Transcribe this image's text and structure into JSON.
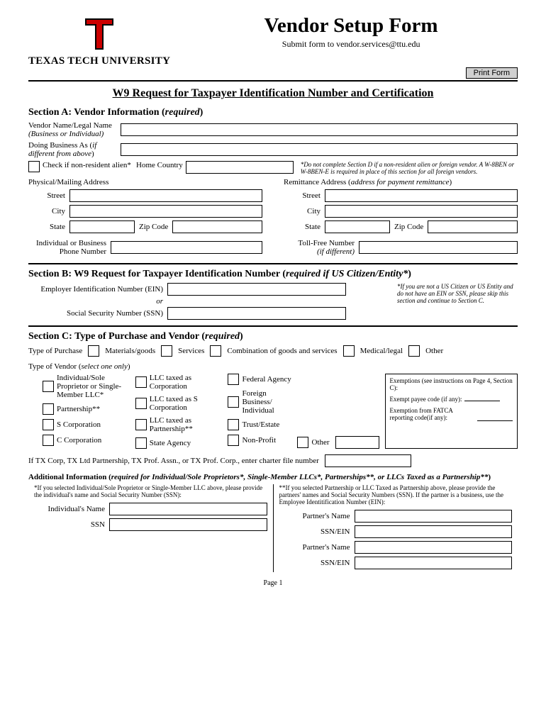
{
  "header": {
    "university": "TEXAS TECH UNIVERSITY",
    "title": "Vendor Setup Form",
    "submit": "Submit form to vendor.services@ttu.edu",
    "print": "Print Form"
  },
  "w9_title": "W9 Request for Taxpayer Identification Number and Certification",
  "secA": {
    "hdr": "Section A: Vendor Information (",
    "hdr_req": "required",
    "hdr_end": ")",
    "vendor_name": "Vendor Name/Legal Name",
    "vendor_name_sub": "(Business or Individual)",
    "dba": "Doing Business As (",
    "dba_sub": "if different from above",
    "dba_end": ")",
    "nonres": "Check if non-resident alien*",
    "home_country": "Home Country",
    "nonres_note": "*Do not complete Section D if a non-resident alien or foreign vendor. A W-8BEN or W-8BEN-E is required in place of this section for all foreign vendors.",
    "phys": "Physical/Mailing Address",
    "remit": "Remittance Address (",
    "remit_sub": "address for payment remittance",
    "remit_end": ")",
    "street": "Street",
    "city": "City",
    "state": "State",
    "zip": "Zip Code",
    "phone": "Individual or Business",
    "phone2": "Phone Number",
    "tollfree": "Toll-Free Number",
    "tollfree_sub": "(if different)"
  },
  "secB": {
    "hdr": "Section B: W9 Request for Taxpayer Identification Number (",
    "hdr_req": "required if US Citizen/Entity*",
    "hdr_end": ")",
    "ein": "Employer Identification Number (EIN)",
    "or": "or",
    "ssn": "Social Security Number (SSN)",
    "note": "*If you are not a US Citizen or US Entity and do not have an EIN or SSN, please skip this section and continue to Section C."
  },
  "secC": {
    "hdr": "Section C: Type of Purchase and Vendor (",
    "hdr_req": "required",
    "hdr_end": ")",
    "top": "Type of Purchase",
    "materials": "Materials/goods",
    "services": "Services",
    "combo": "Combination of goods and services",
    "medical": "Medical/legal",
    "other": "Other",
    "tov": "Type of Vendor (",
    "tov_sub": "select one only",
    "tov_end": ")",
    "v1": "Individual/Sole Proprietor or Single-Member LLC*",
    "v2": "Partnership**",
    "v3": "S Corporation",
    "v4": "C Corporation",
    "v5": "LLC taxed as Corporation",
    "v6": "LLC taxed as S Corporation",
    "v7": "LLC taxed as Partnership**",
    "v8": "State Agency",
    "v9": "Federal Agency",
    "v10": "Foreign Business/ Individual",
    "v11": "Trust/Estate",
    "v12": "Non-Profit",
    "v13": "Other",
    "exempt_hdr": "Exemptions (see instructions on Page 4, Section C):",
    "exempt_payee": "Exempt payee code (if any):",
    "exempt_fatca": "Exemption from FATCA reporting code(if any):",
    "charter": "If TX Corp, TX Ltd Partnership, TX Prof. Assn., or TX Prof. Corp., enter charter file number",
    "addl": "Additional Information (",
    "addl_req": "required for Individual/Sole Proprietors*, Single-Member LLCs*, Partnerships**, or LLCs Taxed as a Partnership**",
    "addl_end": ")",
    "left_note": "*If you selected Individual/Sole Proprietor or Single-Member LLC above, please provide the individual's name and Social Security Number (SSN):",
    "right_note": "**If you selected Partnership or LLC Taxed as Partnership above, please provide the partners' names and Social Security Numbers (SSN). If the partner is a business, use the Employee Identitification Number (EIN):",
    "ind_name": "Individual's Name",
    "ssn": "SSN",
    "partner_name": "Partner's Name",
    "ssn_ein": "SSN/EIN"
  },
  "page": "Page 1"
}
